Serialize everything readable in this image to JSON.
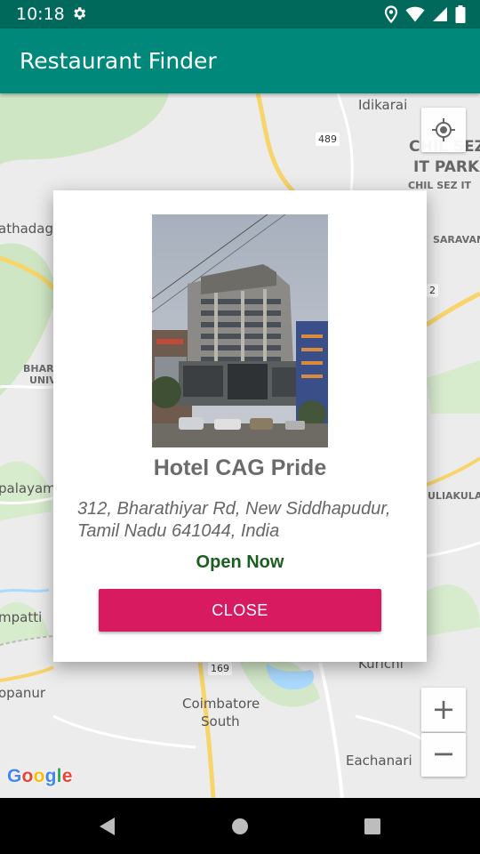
{
  "status_bar": {
    "time": "10:18",
    "icons": [
      "settings-gear-icon",
      "location-icon",
      "wifi-icon",
      "signal-icon",
      "battery-icon"
    ]
  },
  "app_bar": {
    "title": "Restaurant Finder",
    "color": "#00897b",
    "status_color": "#00695c"
  },
  "map": {
    "labels": {
      "idikarai": "Idikarai",
      "chil_sez_top": "CHIL SEZ",
      "it_park": "IT PARK",
      "chil_sez_it": "CHIL SEZ IT",
      "saravana": "SARAVANA",
      "athadag": "athadag",
      "bhara": "BHARA",
      "univ": "UNIV",
      "palayam": "palayam",
      "uliakulam": "ULIAKULAM",
      "mpatti": "mpatti",
      "kurichi": "Kurichi",
      "opanur": "opanur",
      "coimbatore": "Coimbatore",
      "south": "South",
      "eachanari": "Eachanari"
    },
    "road_numbers": {
      "r489": "489",
      "r169": "169",
      "r2": "2"
    },
    "controls": {
      "zoom_in": "+",
      "zoom_out": "−"
    },
    "google_logo": {
      "letters": [
        "G",
        "o",
        "o",
        "g",
        "l",
        "e"
      ],
      "colors": [
        "#4285f4",
        "#ea4335",
        "#fbbc05",
        "#4285f4",
        "#34a853",
        "#ea4335"
      ]
    }
  },
  "dialog": {
    "hotel_name": "Hotel CAG Pride",
    "address": "312, Bharathiyar Rd, New Siddhapudur, Tamil Nadu 641044, India",
    "open_status": "Open Now",
    "close_label": "CLOSE",
    "accent_color": "#d81b60",
    "open_color": "#1b5e20"
  }
}
